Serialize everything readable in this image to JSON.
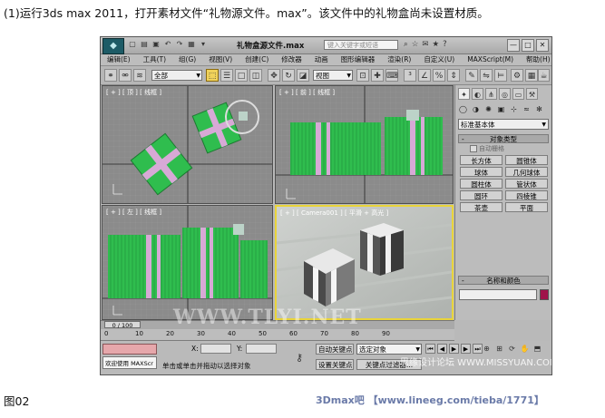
{
  "caption": {
    "top": "(1)运行3ds max 2011，打开素材文件“礼物源文件。max”。该文件中的礼物盒尚未设置材质。",
    "figure": "图02",
    "credit": "3Dmax吧 【www.lineeg.com/tieba/1771】"
  },
  "titlebar": {
    "logo": "◆",
    "title": "礼物盒源文件.max",
    "search_placeholder": "键入关键字或短语",
    "win_min": "—",
    "win_max": "□",
    "win_close": "✕"
  },
  "menu": [
    "编辑(E)",
    "工具(T)",
    "组(G)",
    "视图(V)",
    "创建(C)",
    "修改器",
    "动画",
    "图形编辑器",
    "渲染(R)",
    "自定义(U)",
    "MAXScript(M)",
    "帮助(H)"
  ],
  "toolbar": {
    "selection_filter": "全部",
    "reference_coord": "视图"
  },
  "viewports": {
    "top": "[ + ] [ 顶 ] [ 线框 ]",
    "front": "[ + ] [ 前 ] [ 线框 ]",
    "left": "[ + ] [ 左 ] [ 线框 ]",
    "camera": "[ + ] [ Camera001 ] [ 平滑 + 高光 ]"
  },
  "command_panel": {
    "category": "标准基本体",
    "object_type_title": "对象类型",
    "autogrid": "自动栅格",
    "objects": [
      "长方体",
      "圆锥体",
      "球体",
      "几何球体",
      "圆柱体",
      "管状体",
      "圆环",
      "四棱锥",
      "茶壶",
      "平面"
    ],
    "name_color_title": "名称和颜色",
    "object_color": "#a0134a"
  },
  "timeline": {
    "slider": "0 / 100",
    "ticks": [
      "0",
      "10",
      "20",
      "30",
      "40",
      "50",
      "60",
      "70",
      "80",
      "90"
    ]
  },
  "status": {
    "welcome": "欢迎使用 MAXScr",
    "x_label": "X:",
    "y_label": "Y:",
    "prompt": "单击或单击并拖动以选择对象",
    "auto_key": "自动关键点",
    "set_key": "设置关键点",
    "selected": "选定对象",
    "key_filters": "关键点过滤器..."
  },
  "watermark": {
    "main": "WWW.TLYI.NET",
    "sub": "思缘设计论坛 WWW.MISSYUAN.COM"
  }
}
